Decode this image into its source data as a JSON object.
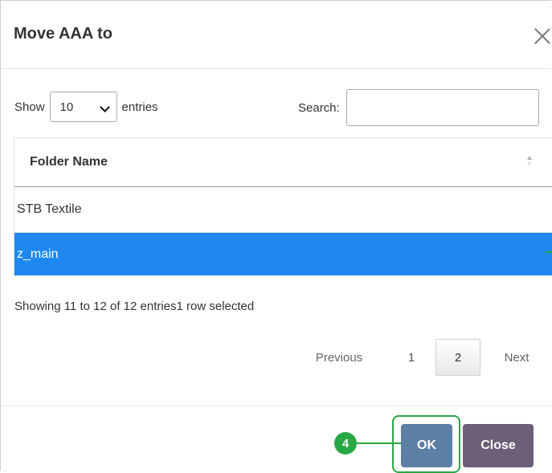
{
  "dialog": {
    "title": "Move AAA to",
    "close_icon": "close-icon"
  },
  "length_menu": {
    "prefix": "Show",
    "selected": "10",
    "suffix": "entries"
  },
  "search": {
    "label": "Search:",
    "value": "",
    "placeholder": ""
  },
  "table": {
    "columns": [
      "Folder Name"
    ],
    "rows": [
      {
        "folder_name": "STB Textile",
        "selected": false
      },
      {
        "folder_name": "z_main",
        "selected": true
      }
    ]
  },
  "info": "Showing 11 to 12 of 12 entries1 row selected",
  "pagination": {
    "previous": "Previous",
    "pages": [
      "1",
      "2"
    ],
    "current": "2",
    "next": "Next"
  },
  "footer": {
    "ok_label": "OK",
    "close_label": "Close"
  },
  "annotation": {
    "step": "4"
  },
  "colors": {
    "selected_row": "#1e88f0",
    "ok_button": "#5c7fa6",
    "close_button": "#6c5f78",
    "annotation": "#29a745"
  }
}
